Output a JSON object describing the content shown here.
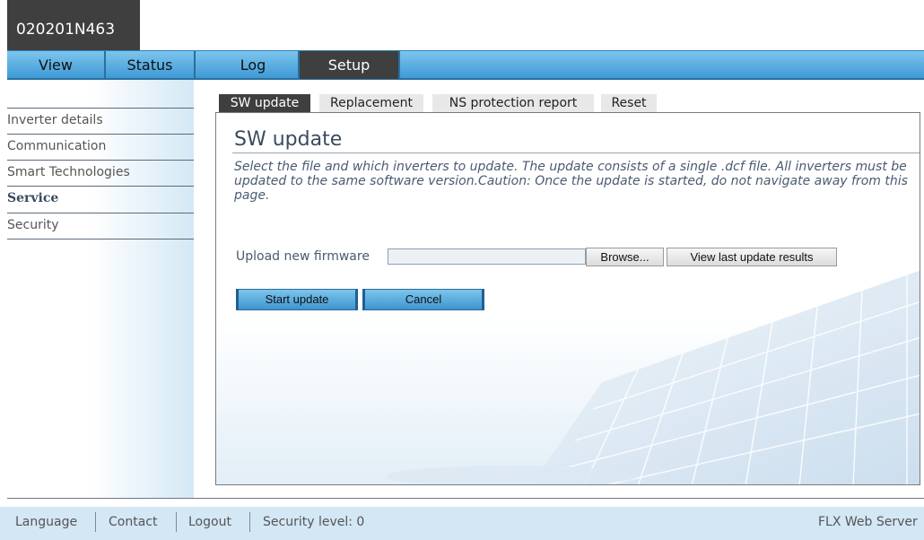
{
  "device": {
    "id": "020201N463"
  },
  "nav": {
    "items": [
      {
        "label": "View"
      },
      {
        "label": "Status"
      },
      {
        "label": "Log"
      },
      {
        "label": "Setup"
      }
    ],
    "active": "Setup"
  },
  "sidebar": {
    "items": [
      {
        "label": "Inverter details"
      },
      {
        "label": "Communication"
      },
      {
        "label": "Smart Technologies"
      },
      {
        "label": "Service"
      },
      {
        "label": "Security"
      }
    ],
    "active": "Service"
  },
  "subtabs": {
    "items": [
      {
        "label": "SW update"
      },
      {
        "label": "Replacement"
      },
      {
        "label": "NS protection report"
      },
      {
        "label": "Reset"
      }
    ],
    "active": "SW update"
  },
  "content": {
    "title": "SW update",
    "description": "Select the file and which inverters to update. The update consists of a single .dcf file. All inverters must be updated to the same software version.Caution: Once the update is started, do not navigate away from this page.",
    "upload_label": "Upload new firmware",
    "upload_value": "",
    "browse_label": "Browse...",
    "view_results_label": "View last update results",
    "start_label": "Start update",
    "cancel_label": "Cancel"
  },
  "footer": {
    "language": "Language",
    "contact": "Contact",
    "logout": "Logout",
    "security_level": "Security level: 0",
    "server": "FLX Web Server"
  },
  "colors": {
    "nav_blue": "#4fa8de",
    "active_tab": "#3f3f3f",
    "footer_bg": "#d3e7f5",
    "text": "#3a4a60"
  }
}
